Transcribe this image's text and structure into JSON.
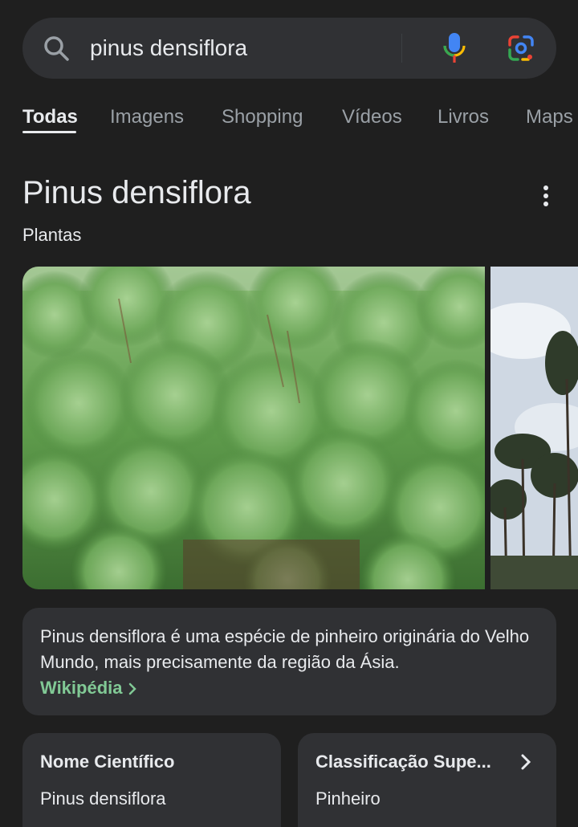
{
  "search": {
    "query": "pinus densiflora"
  },
  "tabs": [
    {
      "label": "Todas",
      "active": true
    },
    {
      "label": "Imagens",
      "active": false
    },
    {
      "label": "Shopping",
      "active": false
    },
    {
      "label": "Vídeos",
      "active": false
    },
    {
      "label": "Livros",
      "active": false
    },
    {
      "label": "Maps",
      "active": false
    }
  ],
  "knowledge_panel": {
    "title": "Pinus densiflora",
    "subtitle": "Plantas",
    "description": "Pinus densiflora é uma espécie de pinheiro originária do Velho Mundo, mais precisamente da região da Ásia.",
    "source_link": "Wikipédia",
    "facts": [
      {
        "label": "Nome Científico",
        "value": "Pinus densiflora"
      },
      {
        "label": "Classificação Supe...",
        "value": "Pinheiro"
      }
    ]
  },
  "icons": {
    "search": "search-icon",
    "mic": "mic-icon",
    "lens": "lens-icon",
    "more": "more-vert-icon",
    "chevron": "chevron-right-icon"
  },
  "colors": {
    "background": "#1f1f1f",
    "surface": "#303134",
    "link_green": "#81c995"
  }
}
